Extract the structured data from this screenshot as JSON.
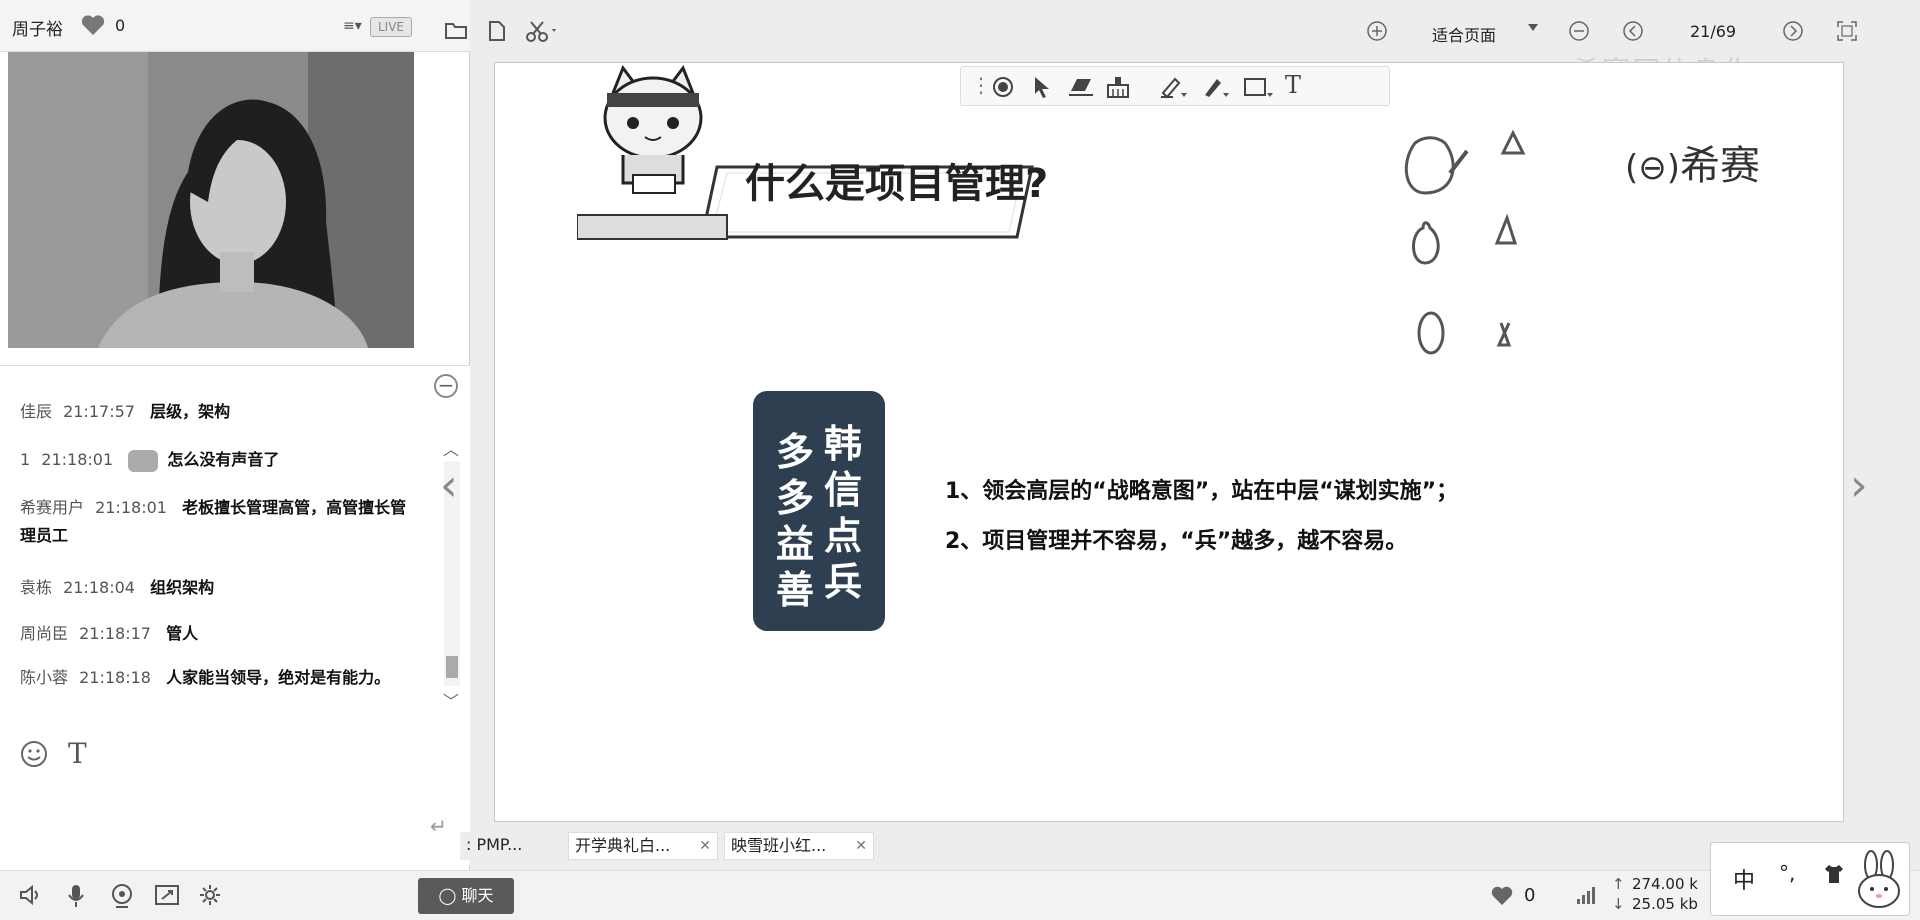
{
  "host": {
    "name": "周子裕",
    "likes": "0",
    "live_label": "LIVE"
  },
  "chat": {
    "messages": [
      {
        "user": "佳辰",
        "time": "21:17:57",
        "text": "层级，架构"
      },
      {
        "user": "1",
        "time": "21:18:01",
        "text": "怎么没有声音了"
      },
      {
        "user": "希赛用户",
        "time": "21:18:01",
        "text": "老板擅长管理高管，高管擅长管理员工"
      },
      {
        "user": "袁栋",
        "time": "21:18:04",
        "text": "组织架构"
      },
      {
        "user": "周尚臣",
        "time": "21:18:17",
        "text": "管人"
      },
      {
        "user": "陈小蓉",
        "time": "21:18:18",
        "text": "人家能当领导，绝对是有能力。"
      }
    ],
    "chat_button_label": "聊天"
  },
  "toolbar": {
    "fit_page_label": "适合页面",
    "page_indicator": "21/69",
    "watermark": "希赛网信息化"
  },
  "slide": {
    "title": "什么是项目管理?",
    "brand": "希赛",
    "quote_col1": [
      "韩",
      "信",
      "点",
      "兵"
    ],
    "quote_col2": [
      "多",
      "多",
      "益",
      "善"
    ],
    "points": [
      "1、领会高层的“战略意图”，站在中层“谋划实施”；",
      "2、项目管理并不容易，“兵”越多，越不容易。"
    ]
  },
  "tabs": [
    {
      "label": ": PMP..."
    },
    {
      "label": "开学典礼白..."
    },
    {
      "label": "映雪班小红..."
    }
  ],
  "status": {
    "likes": "0",
    "upload": "274.00 k",
    "download": "25.05 kb"
  },
  "ime": {
    "mode": "中",
    "punct": "°,"
  },
  "colors": {
    "card_bg": "#2f3f52",
    "accent": "#555555"
  }
}
